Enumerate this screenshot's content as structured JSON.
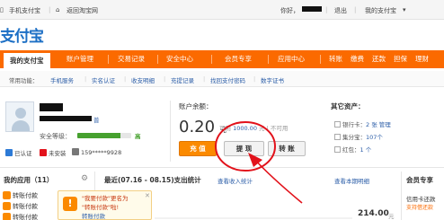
{
  "topbar": {
    "mobile": "手机支付宝",
    "taobao": "返回淘宝网",
    "greeting": "你好，",
    "logout": "退出",
    "myalipay": "我的支付宝"
  },
  "logo": {
    "text": "支付宝"
  },
  "nav": {
    "tabs": [
      "我的支付宝",
      "账户管理",
      "交易记录",
      "安全中心",
      "会员专享",
      "应用中心"
    ],
    "quick": [
      "转账",
      "缴费",
      "还款",
      "担保",
      "理财"
    ]
  },
  "subnav": {
    "label": "常用功能：",
    "items": [
      "手机服务",
      "实名认证",
      "收支明细",
      "充提记录",
      "找回支付密码",
      "数字证书"
    ]
  },
  "profile": {
    "level": "普",
    "security_label": "安全等级：",
    "security_value": "高",
    "security_level": 0.8,
    "verified": "已认证",
    "cert": "未安装",
    "phone": "159*****9928"
  },
  "balance": {
    "title": "账户余额：",
    "amount": "0.20",
    "unit": "元",
    "available_prefix": "可用",
    "available_value": "1000.00",
    "available_suffix": "元 | 不可用"
  },
  "buttons": {
    "recharge": "充 值",
    "withdraw": "提 现",
    "transfer": "转 账"
  },
  "other_assets": {
    "title": "其它资产：",
    "bank_label": "银行卡：",
    "bank_count": "2 张",
    "bank_manage": "管理",
    "points_label": "集分宝：",
    "points_value": "107个",
    "coupon_label": "红包：",
    "coupon_value": "1 个"
  },
  "apps": {
    "title": "我的应用（11）",
    "items": [
      "转账付款",
      "转账付款",
      "转账付款"
    ]
  },
  "stats": {
    "title": "最近(07.16 - 08.15)支出统计",
    "link1": "查看收入统计",
    "link2": "查看本期明细",
    "amount": "214.00",
    "unit": "元"
  },
  "tooltip": {
    "line1_prefix": "\"我要付款\"更名为",
    "line2": "\"转账付款\"啦!",
    "line3": "转账付款"
  },
  "member": {
    "title": "会员专享",
    "line1": "信用卡还款",
    "line2": "支持借还款"
  },
  "colors": {
    "brand_orange": "#fb6a00",
    "link_blue": "#2c5ea8",
    "annotation_red": "#e2121b",
    "safe_green": "#46a12f"
  }
}
